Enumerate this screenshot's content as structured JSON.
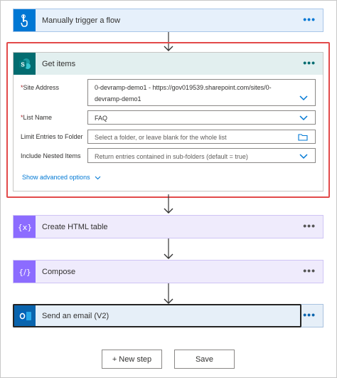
{
  "flow": {
    "trigger": {
      "title": "Manually trigger a flow",
      "more": "•••",
      "icon": "touch-icon"
    },
    "get_items": {
      "title": "Get items",
      "more": "•••",
      "icon": "sharepoint-icon",
      "fields": {
        "site_address": {
          "required_mark": "*",
          "label": "Site Address",
          "value_line1": "0-devramp-demo1 - https://gov019539.sharepoint.com/sites/0-",
          "value_line2": "devramp-demo1"
        },
        "list_name": {
          "required_mark": "*",
          "label": "List Name",
          "value": "FAQ"
        },
        "limit_entries": {
          "label": "Limit Entries to Folder",
          "placeholder": "Select a folder, or leave blank for the whole list"
        },
        "include_nested": {
          "label": "Include Nested Items",
          "value": "Return entries contained in sub-folders (default = true)"
        }
      },
      "advanced_label": "Show advanced options"
    },
    "create_html_table": {
      "title": "Create HTML table",
      "more": "•••",
      "icon": "data-operation-icon"
    },
    "compose": {
      "title": "Compose",
      "more": "•••",
      "icon": "data-operation-icon"
    },
    "send_email": {
      "title": "Send an email (V2)",
      "more": "•••",
      "icon": "outlook-icon"
    }
  },
  "footer": {
    "new_step_label": "+ New step",
    "save_label": "Save"
  },
  "colors": {
    "trigger_accent": "#0077d4",
    "trigger_bg": "#e6f0fb",
    "sharepoint_accent": "#036c70",
    "sharepoint_bg": "#e2efef",
    "dataop_accent": "#8c6cff",
    "dataop_bg": "#efebfc",
    "outlook_accent": "#0a64ad",
    "outlook_bg": "#e6eff8",
    "highlight": "#e24a4a"
  }
}
